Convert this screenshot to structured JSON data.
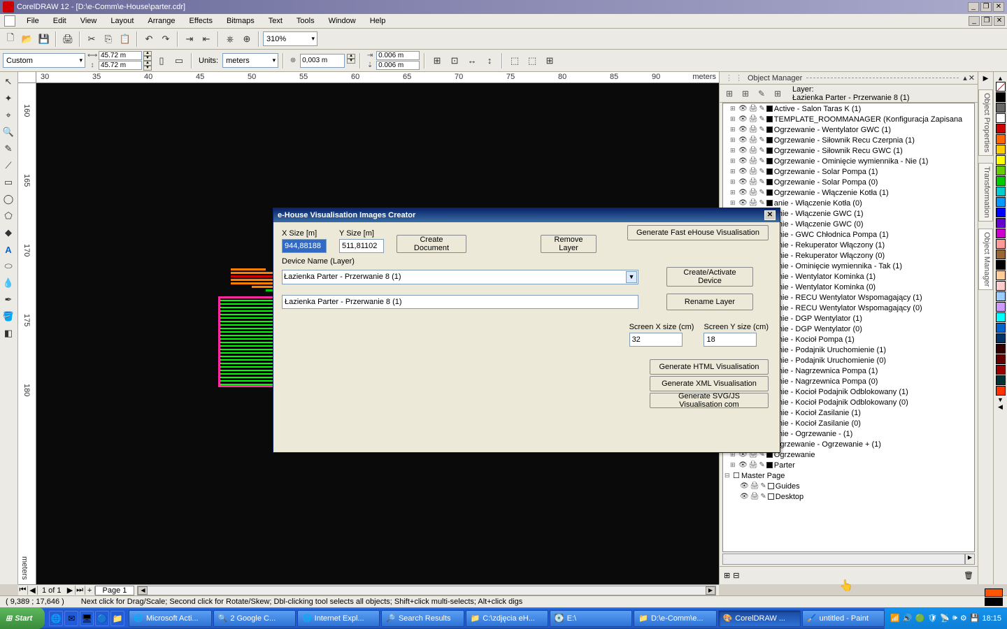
{
  "title": "CorelDRAW 12 - [D:\\e-Comm\\e-House\\parter.cdr]",
  "menus": [
    "File",
    "Edit",
    "View",
    "Layout",
    "Arrange",
    "Effects",
    "Bitmaps",
    "Text",
    "Tools",
    "Window",
    "Help"
  ],
  "zoom": "310%",
  "paper": "Custom",
  "dims": {
    "w": "45.72 m",
    "h": "45.72 m"
  },
  "units_label": "Units:",
  "units": "meters",
  "nudge": "0,003 m",
  "dup": {
    "x": "0.006 m",
    "y": "0.006 m"
  },
  "ruler_h": [
    "30",
    "35",
    "40",
    "45",
    "50",
    "55",
    "60",
    "65",
    "70",
    "75",
    "80",
    "85",
    "90",
    "meters"
  ],
  "ruler_v": [
    "160",
    "165",
    "170",
    "175",
    "180",
    "meters"
  ],
  "pages": {
    "nav": [
      "⏮",
      "◀",
      "1 of 1",
      "▶",
      "⏭",
      "+"
    ],
    "tab": "Page 1"
  },
  "status": {
    "coord": "( 9,389 ; 17,646 )",
    "hint": "Next click for Drag/Scale; Second click for Rotate/Skew; Dbl-clicking tool selects all objects; Shift+click multi-selects; Alt+click digs"
  },
  "docker": {
    "title": "Object Manager",
    "layer_label": "Layer:",
    "layer_name": "Łazienka Parter - Przerwanie 8 (1)",
    "items": [
      "Active - Salon Taras K (1)",
      "TEMPLATE_ROOMMANAGER (Konfiguracja Zapisana",
      "Ogrzewanie - Wentylator GWC (1)",
      "Ogrzewanie - Siłownik Recu Czerpnia (1)",
      "Ogrzewanie - Siłownik Recu GWC (1)",
      "Ogrzewanie - Ominięcie wymiennika - Nie (1)",
      "Ogrzewanie - Solar Pompa (1)",
      "Ogrzewanie - Solar Pompa (0)",
      "Ogrzewanie - Włączenie Kotła (1)",
      "anie - Włączenie Kotła (0)",
      "anie - Włączenie GWC (1)",
      "anie - Włączenie GWC (0)",
      "anie - GWC Chłodnica Pompa (1)",
      "anie - Rekuperator Włączony (1)",
      "anie - Rekuperator Włączony (0)",
      "anie - Ominięcie wymiennika - Tak (1)",
      "anie - Wentylator Kominka (1)",
      "anie - Wentylator Kominka (0)",
      "anie - RECU Wentylator Wspomagający (1)",
      "anie - RECU Wentylator Wspomagający (0)",
      "anie - DGP Wentylator (1)",
      "anie - DGP Wentylator (0)",
      "anie - Kocioł Pompa (1)",
      "anie - Podajnik Uruchomienie (1)",
      "anie - Podajnik Uruchomienie (0)",
      "anie - Nagrzewnica Pompa (1)",
      "anie - Nagrzewnica Pompa (0)",
      "anie - Kocioł Podajnik Odblokowany (1)",
      "anie - Kocioł Podajnik Odblokowany (0)",
      "anie - Kocioł Zasilanie (1)",
      "anie - Kocioł Zasilanie (0)",
      "anie - Ogrzewanie - (1)",
      "Ogrzewanie - Ogrzewanie + (1)",
      "Ogrzewanie",
      "Parter"
    ],
    "master": "Master Page",
    "guides": "Guides",
    "desktop": "Desktop"
  },
  "palette": [
    "#000",
    "#666",
    "#fff",
    "#c00",
    "#f60",
    "#fc0",
    "#ff0",
    "#6c0",
    "#0c0",
    "#0cc",
    "#09f",
    "#00f",
    "#60c",
    "#c0c",
    "#f99",
    "#963",
    "#000",
    "#fc9",
    "#fcc",
    "#9cf",
    "#c9f",
    "#0ff",
    "#06c",
    "#036",
    "#300",
    "#600",
    "#900",
    "#033",
    "#f30"
  ],
  "tabs": [
    "Object Properties",
    "Transformation",
    "Object Manager"
  ],
  "dialog": {
    "title": "e-House Visualisation Images Creator",
    "xsize_lbl": "X Size [m]",
    "xsize": "944,88188",
    "ysize_lbl": "Y Size [m]",
    "ysize": "511,81102",
    "btn_create": "Create Document",
    "btn_remove": "Remove Layer",
    "btn_fast": "Generate Fast eHouse Visualisation",
    "dev_lbl": "Device Name (Layer)",
    "combo": "Łazienka Parter - Przerwanie 8 (1)",
    "txt": "Łazienka Parter - Przerwanie 8 (1)",
    "btn_activate": "Create/Activate Device",
    "btn_rename": "Rename Layer",
    "sx_lbl": "Screen X size (cm)",
    "sx": "32",
    "sy_lbl": "Screen Y size (cm)",
    "sy": "18",
    "btn_html": "Generate HTML Visualisation",
    "btn_xml": "Generate XML Visualisation",
    "btn_svg": "Generate SVG/JS Visualisation com"
  },
  "taskbar": {
    "start": "Start",
    "tasks": [
      {
        "ico": "🌐",
        "t": "Microsoft Acti..."
      },
      {
        "ico": "🔍",
        "t": "2 Google C..."
      },
      {
        "ico": "🌐",
        "t": "Internet Expl..."
      },
      {
        "ico": "🔎",
        "t": "Search Results"
      },
      {
        "ico": "📁",
        "t": "C:\\zdjęcia eH..."
      },
      {
        "ico": "💽",
        "t": "E:\\"
      },
      {
        "ico": "📁",
        "t": "D:\\e-Comm\\e..."
      },
      {
        "ico": "🎨",
        "t": "CorelDRAW ..."
      },
      {
        "ico": "🖌️",
        "t": "untitled - Paint"
      }
    ],
    "clock": "18:15"
  },
  "colorind": {
    "fill": "#ff5500",
    "stroke": "#000"
  }
}
